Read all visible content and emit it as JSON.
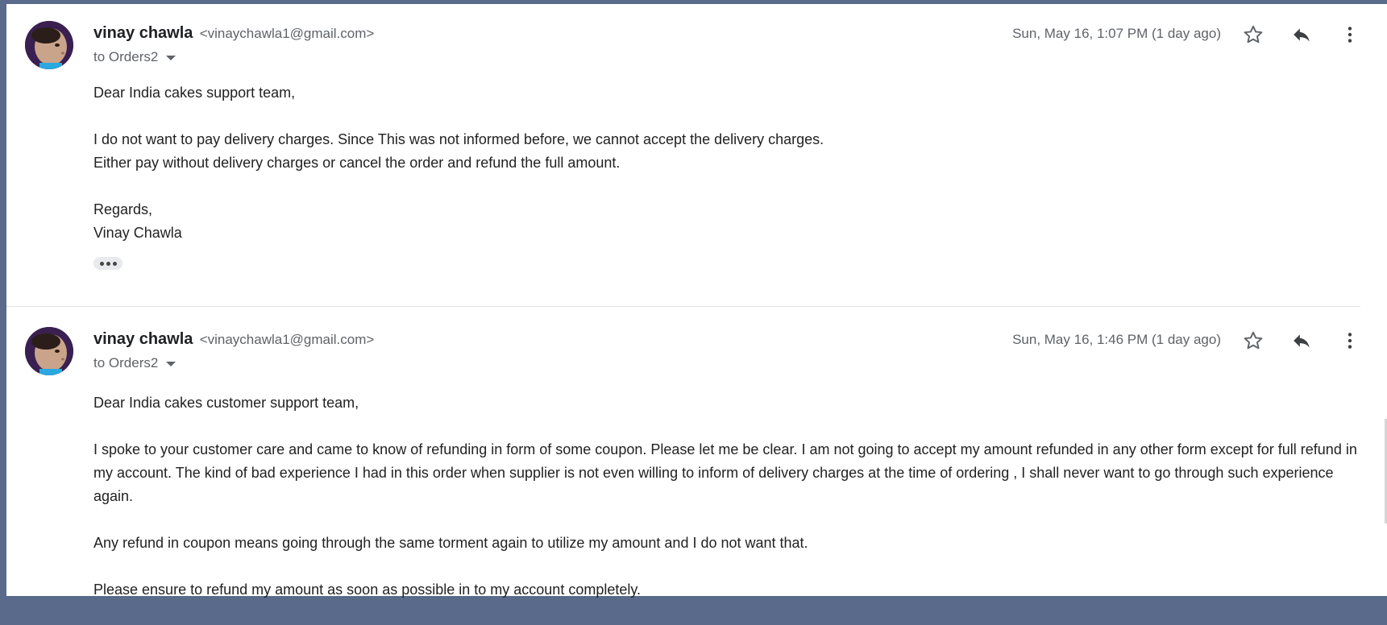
{
  "messages": [
    {
      "sender_name": "vinay chawla",
      "sender_email": "<vinaychawla1@gmail.com>",
      "recipient": "to Orders2",
      "timestamp": "Sun, May 16, 1:07 PM (1 day ago)",
      "body": [
        "Dear India cakes support team,",
        "I do not want to pay delivery charges. Since This was not informed before, we cannot accept the delivery charges.",
        "Either pay without delivery charges or cancel the order and refund the full amount.",
        "Regards,",
        "Vinay Chawla"
      ]
    },
    {
      "sender_name": "vinay chawla",
      "sender_email": "<vinaychawla1@gmail.com>",
      "recipient": "to Orders2",
      "timestamp": "Sun, May 16, 1:46 PM (1 day ago)",
      "body": [
        "Dear India cakes customer support team,",
        "I spoke to your customer care and came to know of refunding in form of some coupon. Please let me be clear. I am not going to accept my amount refunded in any other form except for full refund in my account. The kind of bad experience I had in this order when supplier is not even willing to inform of delivery charges at the time of ordering , I shall never want to go through such experience again.",
        "Any refund in coupon means going through the same torment again to utilize my amount and I do not want that.",
        "Please ensure to refund my amount as soon as possible in to my account completely."
      ]
    }
  ],
  "icons": {
    "star": "star-outline-icon",
    "reply": "reply-icon",
    "more": "more-vertical-icon",
    "expand": "ellipsis-icon"
  },
  "colors": {
    "background": "#5a6a8a",
    "panel": "#ffffff",
    "text": "#222222",
    "muted": "#5f6368"
  }
}
